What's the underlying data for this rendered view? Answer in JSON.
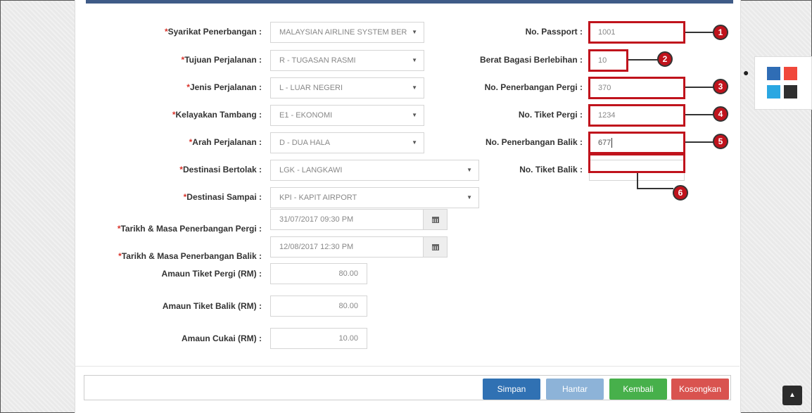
{
  "form": {
    "left_fields": [
      {
        "label": "Syarikat Penerbangan :",
        "required": true,
        "value": "MALAYSIAN AIRLINE SYSTEM BER"
      },
      {
        "label": "Tujuan Perjalanan :",
        "required": true,
        "value": "R - TUGASAN RASMI"
      },
      {
        "label": "Jenis Perjalanan :",
        "required": true,
        "value": "L - LUAR NEGERI"
      },
      {
        "label": "Kelayakan Tambang :",
        "required": true,
        "value": "E1 - EKONOMI"
      },
      {
        "label": "Arah Perjalanan :",
        "required": true,
        "value": "D - DUA HALA"
      },
      {
        "label": "Destinasi Bertolak :",
        "required": true,
        "value": "LGK - LANGKAWI"
      },
      {
        "label": "Destinasi Sampai :",
        "required": true,
        "value": "KPI - KAPIT AIRPORT"
      },
      {
        "label": "Tarikh & Masa Penerbangan Pergi :",
        "required": true,
        "value": "31/07/2017 09:30 PM"
      },
      {
        "label": "Tarikh & Masa Penerbangan Balik :",
        "required": true,
        "value": "12/08/2017 12:30 PM"
      },
      {
        "label": "Amaun Tiket Pergi (RM) :",
        "required": false,
        "value": "80.00"
      },
      {
        "label": "Amaun Tiket Balik (RM) :",
        "required": false,
        "value": "80.00"
      },
      {
        "label": "Amaun Cukai (RM) :",
        "required": false,
        "value": "10.00"
      }
    ],
    "right_fields": [
      {
        "label": "No. Passport :",
        "value": "1001"
      },
      {
        "label": "Berat Bagasi Berlebihan :",
        "value": "10"
      },
      {
        "label": "No. Penerbangan Pergi :",
        "value": "370"
      },
      {
        "label": "No. Tiket Pergi :",
        "value": "1234"
      },
      {
        "label": "No. Penerbangan Balik :",
        "value": "677"
      },
      {
        "label": "No. Tiket Balik :",
        "value": ""
      }
    ],
    "required_mark": "*"
  },
  "callouts": [
    "1",
    "2",
    "3",
    "4",
    "5",
    "6"
  ],
  "buttons": {
    "simpan": "Simpan",
    "hantar": "Hantar",
    "kembali": "Kembali",
    "kosongkan": "Kosongkan"
  },
  "icons": {
    "select_caret": "caret-down-icon",
    "calendar": "calendar-icon",
    "theme": "drop-icon",
    "scroll_top": "chevron-up-icon"
  },
  "colors": {
    "required": "#d9332a",
    "highlight": "#c0131c",
    "swatches": [
      "#2f6db5",
      "#f0483b",
      "#2aa7e2",
      "#2f2f2f"
    ],
    "btn_simpan": "#3071b3",
    "btn_hantar": "#8db3d8",
    "btn_kembali": "#47b04b",
    "btn_kosongkan": "#d9534f"
  }
}
